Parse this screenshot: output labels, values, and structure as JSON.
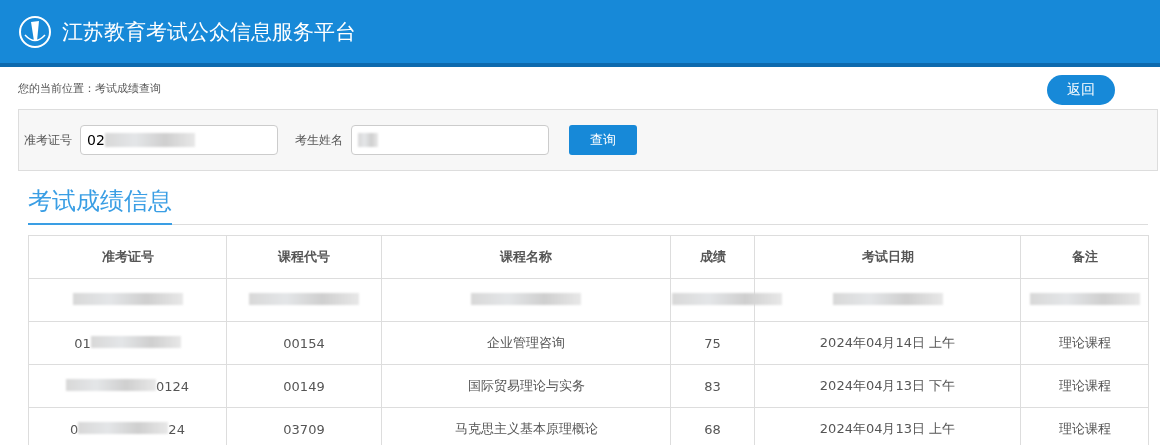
{
  "header": {
    "title": "江苏教育考试公众信息服务平台"
  },
  "breadcrumb": "您的当前位置：考试成绩查询",
  "back_button": "返回",
  "search": {
    "fields": [
      {
        "label": "准考证号",
        "value": "02",
        "redacted": true
      },
      {
        "label": "考生姓名",
        "redacted": true
      }
    ],
    "button": "查询"
  },
  "section_title": "考试成绩信息",
  "table": {
    "columns": [
      "准考证号",
      "课程代号",
      "课程名称",
      "成绩",
      "考试日期",
      "备注"
    ],
    "rows": [
      [
        {
          "redacted": true
        },
        {
          "redacted": true
        },
        {
          "redacted": true
        },
        {
          "redacted": true
        },
        {
          "redacted": true
        },
        {
          "redacted": true
        }
      ],
      [
        {
          "text": "01",
          "redacted": true
        },
        {
          "text": "00154",
          "redacted": false
        },
        {
          "text": "企业管理咨询",
          "redacted": false
        },
        {
          "text": "75",
          "redacted": false
        },
        {
          "text": "2024年04月14日 上午",
          "redacted": false
        },
        {
          "text": "理论课程",
          "redacted": false
        }
      ],
      [
        {
          "redacted": true,
          "tail": "0124"
        },
        {
          "text": "00149",
          "redacted": false
        },
        {
          "text": "国际贸易理论与实务",
          "redacted": false
        },
        {
          "text": "83",
          "redacted": false
        },
        {
          "text": "2024年04月13日 下午",
          "redacted": false
        },
        {
          "text": "理论课程",
          "redacted": false
        }
      ],
      [
        {
          "text": "0",
          "redacted": true,
          "tail": "24"
        },
        {
          "text": "03709",
          "redacted": false
        },
        {
          "text": "马克思主义基本原理概论",
          "redacted": false
        },
        {
          "text": "68",
          "redacted": false
        },
        {
          "text": "2024年04月13日 上午",
          "redacted": false
        },
        {
          "text": "理论课程",
          "redacted": false
        }
      ]
    ]
  }
}
